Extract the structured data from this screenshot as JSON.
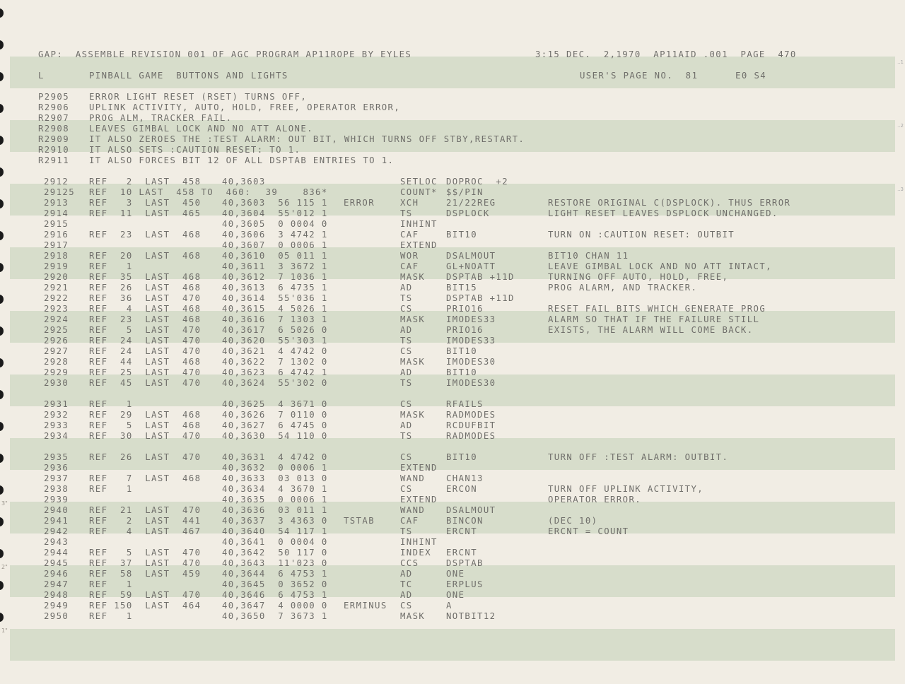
{
  "header": {
    "left": "GAP:  ASSEMBLE REVISION 001 OF AGC PROGRAM AP11ROPE BY EYLES",
    "right": "3:15 DEC.  2,1970  AP11AID .001  PAGE  470",
    "section_left": "L",
    "section_title": "PINBALL GAME  BUTTONS AND LIGHTS",
    "section_right": "USER'S PAGE NO.  81      E0 S4"
  },
  "margin_marks": [
    "3\"",
    "2\"",
    "1\""
  ],
  "right_ticks": [
    "..1",
    "..2",
    "..3"
  ],
  "remarks": [
    {
      "num": "P2905",
      "text": "ERROR LIGHT RESET (RSET) TURNS OFF,"
    },
    {
      "num": "R2906",
      "text": "UPLINK ACTIVITY, AUTO, HOLD, FREE, OPERATOR ERROR,"
    },
    {
      "num": "R2907",
      "text": "PROG ALM, TRACKER FAIL."
    },
    {
      "num": "R2908",
      "text": "LEAVES GIMBAL LOCK AND NO ATT ALONE."
    },
    {
      "num": "R2909",
      "text": "IT ALSO ZEROES THE :TEST ALARM: OUT BIT, WHICH TURNS OFF STBY,RESTART."
    },
    {
      "num": "R2910",
      "text": "IT ALSO SETS :CAUTION RESET: TO 1."
    },
    {
      "num": "R2911",
      "text": "IT ALSO FORCES BIT 12 OF ALL DSPTAB ENTRIES TO 1."
    }
  ],
  "code_lines": [
    {
      "num": "2912",
      "ref": "REF   2  LAST  458",
      "addr": "40,3603",
      "loc": "",
      "op": "SETLOC",
      "opnd": "DOPROC  +2",
      "cmt": ""
    },
    {
      "num": "29125",
      "ref": "REF  10 LAST  458 TO  460:",
      "addr": "       39    836*",
      "loc": "",
      "op": "COUNT*",
      "opnd": "$$/PIN",
      "cmt": ""
    },
    {
      "num": "2913",
      "ref": "REF   3  LAST  450",
      "addr": "40,3603  56 115 1",
      "loc": "ERROR",
      "op": "XCH",
      "opnd": "21/22REG",
      "cmt": "RESTORE ORIGINAL C(DSPLOCK). THUS ERROR"
    },
    {
      "num": "2914",
      "ref": "REF  11  LAST  465",
      "addr": "40,3604  55'012 1",
      "loc": "",
      "op": "TS",
      "opnd": "DSPLOCK",
      "cmt": "LIGHT RESET LEAVES DSPLOCK UNCHANGED."
    },
    {
      "num": "2915",
      "ref": "",
      "addr": "40,3605  0 0004 0",
      "loc": "",
      "op": "INHINT",
      "opnd": "",
      "cmt": ""
    },
    {
      "num": "2916",
      "ref": "REF  23  LAST  468",
      "addr": "40,3606  3 4742 1",
      "loc": "",
      "op": "CAF",
      "opnd": "BIT10",
      "cmt": "TURN ON :CAUTION RESET: OUTBIT"
    },
    {
      "num": "2917",
      "ref": "",
      "addr": "40,3607  0 0006 1",
      "loc": "",
      "op": "EXTEND",
      "opnd": "",
      "cmt": ""
    },
    {
      "num": "2918",
      "ref": "REF  20  LAST  468",
      "addr": "40,3610  05 011 1",
      "loc": "",
      "op": "WOR",
      "opnd": "DSALMOUT",
      "cmt": "BIT10 CHAN 11"
    },
    {
      "num": "2919",
      "ref": "REF   1",
      "addr": "40,3611  3 3672 1",
      "loc": "",
      "op": "CAF",
      "opnd": "GL+NOATT",
      "cmt": "LEAVE GIMBAL LOCK AND NO ATT INTACT,"
    },
    {
      "num": "2920",
      "ref": "REF  35  LAST  468",
      "addr": "40,3612  7 1036 1",
      "loc": "",
      "op": "MASK",
      "opnd": "DSPTAB +11D",
      "cmt": "TURNING OFF AUTO, HOLD, FREE,"
    },
    {
      "num": "2921",
      "ref": "REF  26  LAST  468",
      "addr": "40,3613  6 4735 1",
      "loc": "",
      "op": "AD",
      "opnd": "BIT15",
      "cmt": "PROG ALARM, AND TRACKER."
    },
    {
      "num": "2922",
      "ref": "REF  36  LAST  470",
      "addr": "40,3614  55'036 1",
      "loc": "",
      "op": "TS",
      "opnd": "DSPTAB +11D",
      "cmt": ""
    },
    {
      "num": "2923",
      "ref": "REF   4  LAST  468",
      "addr": "40,3615  4 5026 1",
      "loc": "",
      "op": "CS",
      "opnd": "PRIO16",
      "cmt": "RESET FAIL BITS WHICH GENERATE PROG"
    },
    {
      "num": "2924",
      "ref": "REF  23  LAST  468",
      "addr": "40,3616  7 1303 1",
      "loc": "",
      "op": "MASK",
      "opnd": "IMODES33",
      "cmt": "ALARM SO THAT IF THE FAILURE STILL"
    },
    {
      "num": "2925",
      "ref": "REF   5  LAST  470",
      "addr": "40,3617  6 5026 0",
      "loc": "",
      "op": "AD",
      "opnd": "PRIO16",
      "cmt": "EXISTS, THE ALARM WILL COME BACK."
    },
    {
      "num": "2926",
      "ref": "REF  24  LAST  470",
      "addr": "40,3620  55'303 1",
      "loc": "",
      "op": "TS",
      "opnd": "IMODES33",
      "cmt": ""
    },
    {
      "num": "2927",
      "ref": "REF  24  LAST  470",
      "addr": "40,3621  4 4742 0",
      "loc": "",
      "op": "CS",
      "opnd": "BIT10",
      "cmt": ""
    },
    {
      "num": "2928",
      "ref": "REF  44  LAST  468",
      "addr": "40,3622  7 1302 0",
      "loc": "",
      "op": "MASK",
      "opnd": "IMODES30",
      "cmt": ""
    },
    {
      "num": "2929",
      "ref": "REF  25  LAST  470",
      "addr": "40,3623  6 4742 1",
      "loc": "",
      "op": "AD",
      "opnd": "BIT10",
      "cmt": ""
    },
    {
      "num": "2930",
      "ref": "REF  45  LAST  470",
      "addr": "40,3624  55'302 0",
      "loc": "",
      "op": "TS",
      "opnd": "IMODES30",
      "cmt": ""
    },
    {
      "num": "2931",
      "ref": "REF   1",
      "addr": "40,3625  4 3671 0",
      "loc": "",
      "op": "CS",
      "opnd": "RFAILS",
      "cmt": ""
    },
    {
      "num": "2932",
      "ref": "REF  29  LAST  468",
      "addr": "40,3626  7 0110 0",
      "loc": "",
      "op": "MASK",
      "opnd": "RADMODES",
      "cmt": ""
    },
    {
      "num": "2933",
      "ref": "REF   5  LAST  468",
      "addr": "40,3627  6 4745 0",
      "loc": "",
      "op": "AD",
      "opnd": "RCDUFBIT",
      "cmt": ""
    },
    {
      "num": "2934",
      "ref": "REF  30  LAST  470",
      "addr": "40,3630  54 110 0",
      "loc": "",
      "op": "TS",
      "opnd": "RADMODES",
      "cmt": ""
    },
    {
      "num": "2935",
      "ref": "REF  26  LAST  470",
      "addr": "40,3631  4 4742 0",
      "loc": "",
      "op": "CS",
      "opnd": "BIT10",
      "cmt": "TURN OFF :TEST ALARM: OUTBIT."
    },
    {
      "num": "2936",
      "ref": "",
      "addr": "40,3632  0 0006 1",
      "loc": "",
      "op": "EXTEND",
      "opnd": "",
      "cmt": ""
    },
    {
      "num": "2937",
      "ref": "REF   7  LAST  468",
      "addr": "40,3633  03 013 0",
      "loc": "",
      "op": "WAND",
      "opnd": "CHAN13",
      "cmt": ""
    },
    {
      "num": "2938",
      "ref": "REF   1",
      "addr": "40,3634  4 3670 1",
      "loc": "",
      "op": "CS",
      "opnd": "ERCON",
      "cmt": "TURN OFF UPLINK ACTIVITY,"
    },
    {
      "num": "2939",
      "ref": "",
      "addr": "40,3635  0 0006 1",
      "loc": "",
      "op": "EXTEND",
      "opnd": "",
      "cmt": "OPERATOR ERROR."
    },
    {
      "num": "2940",
      "ref": "REF  21  LAST  470",
      "addr": "40,3636  03 011 1",
      "loc": "",
      "op": "WAND",
      "opnd": "DSALMOUT",
      "cmt": ""
    },
    {
      "num": "2941",
      "ref": "REF   2  LAST  441",
      "addr": "40,3637  3 4363 0",
      "loc": "TSTAB",
      "op": "CAF",
      "opnd": "BINCON",
      "cmt": "(DEC 10)"
    },
    {
      "num": "2942",
      "ref": "REF   4  LAST  467",
      "addr": "40,3640  54 117 1",
      "loc": "",
      "op": "TS",
      "opnd": "ERCNT",
      "cmt": "ERCNT = COUNT"
    },
    {
      "num": "2943",
      "ref": "",
      "addr": "40,3641  0 0004 0",
      "loc": "",
      "op": "INHINT",
      "opnd": "",
      "cmt": ""
    },
    {
      "num": "2944",
      "ref": "REF   5  LAST  470",
      "addr": "40,3642  50 117 0",
      "loc": "",
      "op": "INDEX",
      "opnd": "ERCNT",
      "cmt": ""
    },
    {
      "num": "2945",
      "ref": "REF  37  LAST  470",
      "addr": "40,3643  11'023 0",
      "loc": "",
      "op": "CCS",
      "opnd": "DSPTAB",
      "cmt": ""
    },
    {
      "num": "2946",
      "ref": "REF  58  LAST  459",
      "addr": "40,3644  6 4753 1",
      "loc": "",
      "op": "AD",
      "opnd": "ONE",
      "cmt": ""
    },
    {
      "num": "2947",
      "ref": "REF   1",
      "addr": "40,3645  0 3652 0",
      "loc": "",
      "op": "TC",
      "opnd": "ERPLUS",
      "cmt": ""
    },
    {
      "num": "2948",
      "ref": "REF  59  LAST  470",
      "addr": "40,3646  6 4753 1",
      "loc": "",
      "op": "AD",
      "opnd": "ONE",
      "cmt": ""
    },
    {
      "num": "2949",
      "ref": "REF 150  LAST  464",
      "addr": "40,3647  4 0000 0",
      "loc": "ERMINUS",
      "op": "CS",
      "opnd": "A",
      "cmt": ""
    },
    {
      "num": "2950",
      "ref": "REF   1",
      "addr": "40,3650  7 3673 1",
      "loc": "",
      "op": "MASK",
      "opnd": "NOTBIT12",
      "cmt": ""
    }
  ]
}
